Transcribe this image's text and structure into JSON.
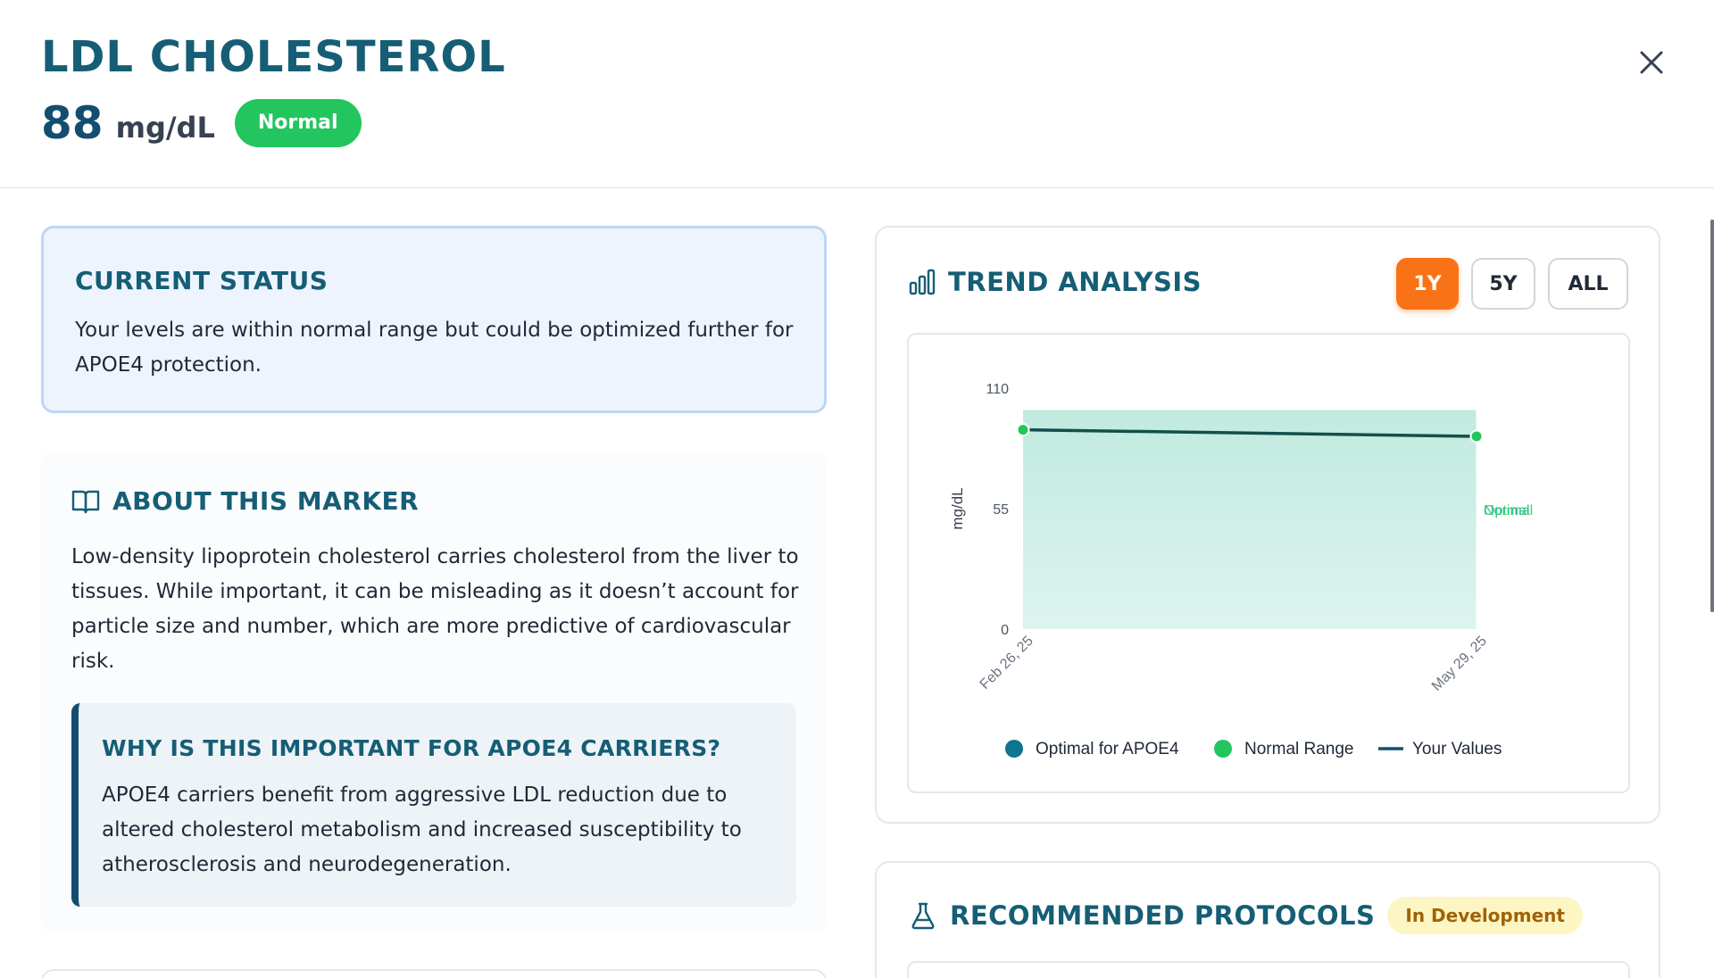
{
  "marker": {
    "title": "LDL CHOLESTEROL",
    "value": "88",
    "unit": "mg/dL",
    "status": "Normal"
  },
  "current_status": {
    "title": "CURRENT STATUS",
    "text": "Your levels are within normal range but could be optimized further for APOE4 protection."
  },
  "about": {
    "title": "ABOUT THIS MARKER",
    "text": "Low-density lipoprotein cholesterol carries cholesterol from the liver to tissues. While important, it can be misleading as it doesn’t account for particle size and number, which are more predictive of cardiovascular risk.",
    "why_title": "WHY IS THIS IMPORTANT FOR APOE4 CARRIERS?",
    "why_text": "APOE4 carriers benefit from aggressive LDL reduction due to altered cholesterol metabolism and increased susceptibility to atherosclerosis and neurodegeneration."
  },
  "trend": {
    "title": "TREND ANALYSIS",
    "ranges": [
      "1Y",
      "5Y",
      "ALL"
    ],
    "active_range": "1Y"
  },
  "protocols": {
    "title": "RECOMMENDED PROTOCOLS",
    "badge": "In Development"
  },
  "icons": {
    "close": "close-icon",
    "trend": "bar-chart-icon",
    "about": "book-open-icon",
    "protocols": "flask-icon"
  },
  "colors": {
    "primary": "#155e75",
    "normal": "#22c55e",
    "active_range": "#f97316",
    "optimal": "#0e7490",
    "line": "#134e4a",
    "band": "#ccefe6"
  },
  "chart_data": {
    "type": "line",
    "ylabel": "mg/dL",
    "ylim": [
      0,
      110
    ],
    "yticks": [
      "0",
      "55",
      "110"
    ],
    "x": [
      "Feb 26, 25",
      "May 29, 25"
    ],
    "series": [
      {
        "name": "Your Values",
        "values": [
          91,
          88
        ]
      }
    ],
    "bands": [
      {
        "name": "Normal Range",
        "from": 0,
        "to": 100
      },
      {
        "name": "Optimal for APOE4",
        "from": 0,
        "to": 100
      }
    ],
    "band_labels": [
      "Normal",
      "Optimal"
    ],
    "legend": [
      "Optimal for APOE4",
      "Normal Range",
      "Your Values"
    ],
    "legend_position": "bottom"
  }
}
